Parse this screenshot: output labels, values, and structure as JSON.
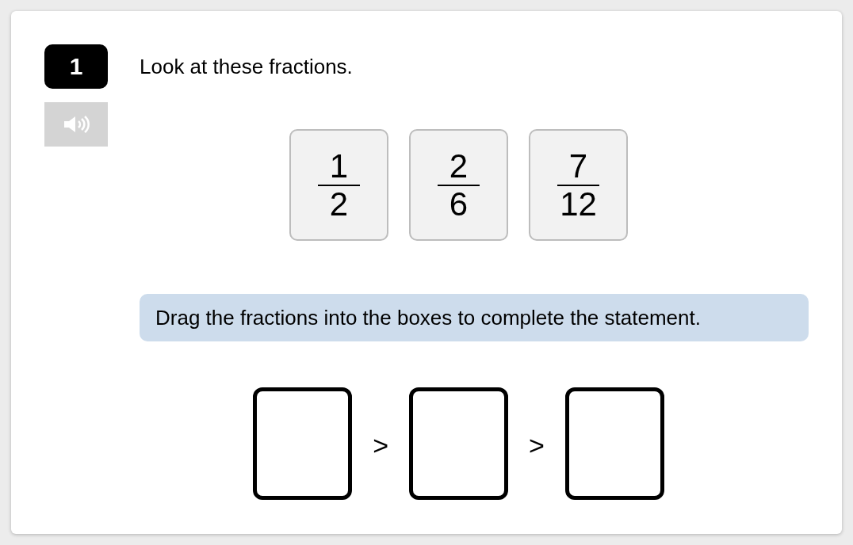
{
  "question": {
    "number": "1",
    "prompt": "Look at these fractions.",
    "fractions": [
      {
        "numerator": "1",
        "denominator": "2"
      },
      {
        "numerator": "2",
        "denominator": "6"
      },
      {
        "numerator": "7",
        "denominator": "12"
      }
    ],
    "instruction": "Drag the fractions into the boxes to complete the statement.",
    "statement": [
      {
        "kind": "box"
      },
      {
        "kind": "symbol",
        "text": ">"
      },
      {
        "kind": "box"
      },
      {
        "kind": "symbol",
        "text": ">"
      },
      {
        "kind": "box"
      }
    ]
  }
}
